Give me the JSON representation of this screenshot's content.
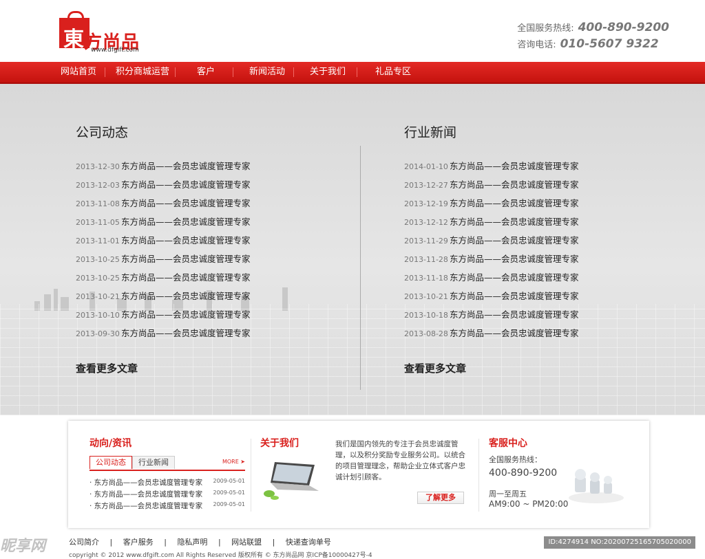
{
  "brand": {
    "logo_char": "東",
    "logo_text": "方尚品",
    "url": "www.dfgift.com"
  },
  "hotline": {
    "label1": "全国服务热线:",
    "number1": "400-890-9200",
    "label2": "咨询电话:",
    "number2": "010-5607 9322"
  },
  "nav": [
    "网站首页",
    "积分商城运营",
    "客户",
    "新闻活动",
    "关于我们",
    "礼品专区"
  ],
  "company_news": {
    "title": "公司动态",
    "items": [
      {
        "date": "2013-12-30",
        "title": "东方尚品——会员忠诚度管理专家"
      },
      {
        "date": "2013-12-03",
        "title": "东方尚品——会员忠诚度管理专家"
      },
      {
        "date": "2013-11-08",
        "title": "东方尚品——会员忠诚度管理专家"
      },
      {
        "date": "2013-11-05",
        "title": "东方尚品——会员忠诚度管理专家"
      },
      {
        "date": "2013-11-01",
        "title": "东方尚品——会员忠诚度管理专家"
      },
      {
        "date": "2013-10-25",
        "title": "东方尚品——会员忠诚度管理专家"
      },
      {
        "date": "2013-10-25",
        "title": "东方尚品——会员忠诚度管理专家"
      },
      {
        "date": "2013-10-21",
        "title": "东方尚品——会员忠诚度管理专家"
      },
      {
        "date": "2013-10-10",
        "title": "东方尚品——会员忠诚度管理专家"
      },
      {
        "date": "2013-09-30",
        "title": "东方尚品——会员忠诚度管理专家"
      }
    ],
    "more": "查看更多文章"
  },
  "industry_news": {
    "title": "行业新闻",
    "items": [
      {
        "date": "2014-01-10",
        "title": "东方尚品——会员忠诚度管理专家"
      },
      {
        "date": "2013-12-27",
        "title": "东方尚品——会员忠诚度管理专家"
      },
      {
        "date": "2013-12-19",
        "title": "东方尚品——会员忠诚度管理专家"
      },
      {
        "date": "2013-12-12",
        "title": "东方尚品——会员忠诚度管理专家"
      },
      {
        "date": "2013-11-29",
        "title": "东方尚品——会员忠诚度管理专家"
      },
      {
        "date": "2013-11-28",
        "title": "东方尚品——会员忠诚度管理专家"
      },
      {
        "date": "2013-11-18",
        "title": "东方尚品——会员忠诚度管理专家"
      },
      {
        "date": "2013-10-21",
        "title": "东方尚品——会员忠诚度管理专家"
      },
      {
        "date": "2013-10-18",
        "title": "东方尚品——会员忠诚度管理专家"
      },
      {
        "date": "2013-08-28",
        "title": "东方尚品——会员忠诚度管理专家"
      }
    ],
    "more": "查看更多文章"
  },
  "panel": {
    "news_title": "动向/资讯",
    "tab_active": "公司动态",
    "tab_other": "行业新闻",
    "more_tag": "MORE ➤",
    "mini_items": [
      {
        "title": "· 东方尚品——会员忠诚度管理专家",
        "date": "2009-05-01"
      },
      {
        "title": "· 东方尚品——会员忠诚度管理专家",
        "date": "2009-05-01"
      },
      {
        "title": "· 东方尚品——会员忠诚度管理专家",
        "date": "2009-05-01"
      }
    ],
    "about_title": "关于我们",
    "about_text": "我们是国内领先的专注于会员忠诚度管理，以及积分奖励专业服务公司。以统合的项目管理理念，帮助企业立体式客户忠诚计划引顾客。",
    "about_more": "了解更多",
    "cs_title": "客服中心",
    "cs_label": "全国服务热线：",
    "cs_number": "400-890-9200",
    "cs_time1": "周一至周五",
    "cs_time2": "AM9:00 ~ PM20:00"
  },
  "footer": {
    "links": [
      "公司简介",
      "|",
      "客户服务",
      "|",
      "隐私声明",
      "|",
      "网站联盟",
      "|",
      "快递查询单号"
    ],
    "copyright": "copyright © 2012 www.dfgift.com All Rights Reserved 版权所有 © 东方尚品网 京ICP备10000427号-4"
  },
  "watermark": {
    "left": "昵享网",
    "right": "ID:4274914 NO:20200725165705020000"
  },
  "colors": {
    "brand_red": "#d9201d",
    "main_bg": "#dedede"
  }
}
